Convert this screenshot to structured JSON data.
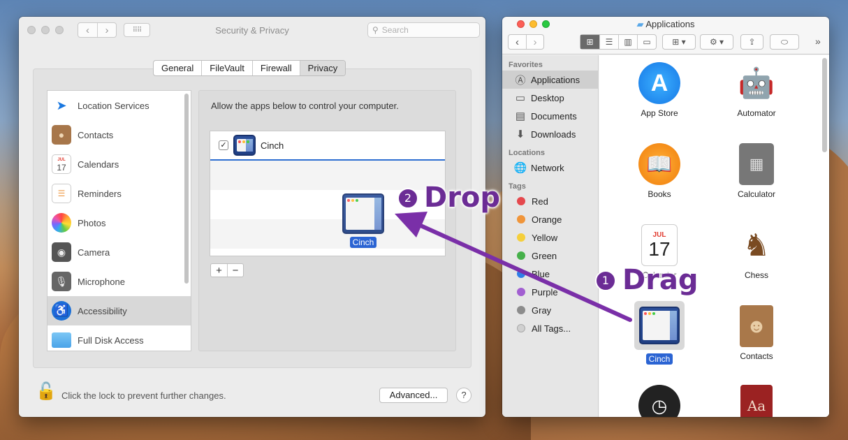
{
  "security_window": {
    "title": "Security & Privacy",
    "search_placeholder": "Search",
    "tabs": [
      "General",
      "FileVault",
      "Firewall",
      "Privacy"
    ],
    "selected_tab": "Privacy",
    "categories": [
      {
        "label": "Location Services",
        "icon": "location-arrow-icon"
      },
      {
        "label": "Contacts",
        "icon": "contacts-book-icon"
      },
      {
        "label": "Calendars",
        "icon": "calendar-icon"
      },
      {
        "label": "Reminders",
        "icon": "reminders-list-icon"
      },
      {
        "label": "Photos",
        "icon": "photos-flower-icon"
      },
      {
        "label": "Camera",
        "icon": "camera-icon"
      },
      {
        "label": "Microphone",
        "icon": "microphone-icon"
      },
      {
        "label": "Accessibility",
        "icon": "accessibility-icon"
      },
      {
        "label": "Full Disk Access",
        "icon": "folder-icon"
      }
    ],
    "selected_category": "Accessibility",
    "panel_message": "Allow the apps below to control your computer.",
    "apps": [
      {
        "name": "Cinch",
        "checked": true,
        "check_glyph": "✓"
      }
    ],
    "add_label": "+",
    "remove_label": "−",
    "lock_text": "Click the lock to prevent further changes.",
    "advanced_label": "Advanced...",
    "help_label": "?",
    "calendar_month": "JUL",
    "calendar_day": "17"
  },
  "finder_window": {
    "title": "Applications",
    "sidebar": {
      "favorites_header": "Favorites",
      "favorites": [
        {
          "label": "Applications",
          "icon": "applications-icon"
        },
        {
          "label": "Desktop",
          "icon": "desktop-icon"
        },
        {
          "label": "Documents",
          "icon": "documents-icon"
        },
        {
          "label": "Downloads",
          "icon": "downloads-icon"
        }
      ],
      "locations_header": "Locations",
      "locations": [
        {
          "label": "Network",
          "icon": "network-globe-icon"
        }
      ],
      "tags_header": "Tags",
      "tags": [
        {
          "label": "Red",
          "color": "#e5484d"
        },
        {
          "label": "Orange",
          "color": "#f0953a"
        },
        {
          "label": "Yellow",
          "color": "#f5cf3b"
        },
        {
          "label": "Green",
          "color": "#46b04a"
        },
        {
          "label": "Blue",
          "color": "#2f7ee8"
        },
        {
          "label": "Purple",
          "color": "#a25fd1"
        },
        {
          "label": "Gray",
          "color": "#8c8c8c"
        },
        {
          "label": "All Tags...",
          "color": "#d0d0d0"
        }
      ]
    },
    "apps": [
      {
        "label": "App Store"
      },
      {
        "label": "Automator"
      },
      {
        "label": "Books"
      },
      {
        "label": "Calculator"
      },
      {
        "label": "Calendar"
      },
      {
        "label": "Chess"
      },
      {
        "label": "Cinch"
      },
      {
        "label": "Contacts"
      }
    ]
  },
  "overlay": {
    "step1_number": "1",
    "step1_text": "Drag",
    "step2_number": "2",
    "step2_text": "Drop",
    "dragged_label": "Cinch",
    "arrow_color": "#7a2fa8"
  }
}
